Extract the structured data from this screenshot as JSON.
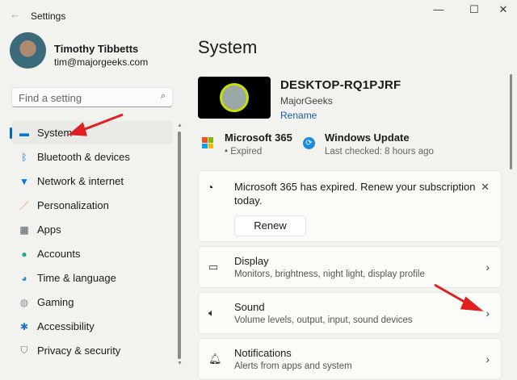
{
  "window": {
    "title": "Settings",
    "minimize": "—",
    "maximize": "☐",
    "close": "✕",
    "back": "←"
  },
  "user": {
    "name": "Timothy Tibbetts",
    "email": "tim@majorgeeks.com"
  },
  "search": {
    "placeholder": "Find a setting"
  },
  "nav": [
    {
      "label": "System",
      "icon": "monitor-icon",
      "glyph": "▬",
      "color": "#0078d4"
    },
    {
      "label": "Bluetooth & devices",
      "icon": "bluetooth-icon",
      "glyph": "ᛒ",
      "color": "#0078d4"
    },
    {
      "label": "Network & internet",
      "icon": "wifi-icon",
      "glyph": "▼",
      "color": "#0078d4"
    },
    {
      "label": "Personalization",
      "icon": "brush-icon",
      "glyph": "／",
      "color": "#e08a3c"
    },
    {
      "label": "Apps",
      "icon": "apps-icon",
      "glyph": "▦",
      "color": "#4a5560"
    },
    {
      "label": "Accounts",
      "icon": "person-icon",
      "glyph": "●",
      "color": "#2ba58a"
    },
    {
      "label": "Time & language",
      "icon": "globe-clock-icon",
      "glyph": "◕",
      "color": "#2a8bd0"
    },
    {
      "label": "Gaming",
      "icon": "gamepad-icon",
      "glyph": "◍",
      "color": "#8a9098"
    },
    {
      "label": "Accessibility",
      "icon": "accessibility-icon",
      "glyph": "✱",
      "color": "#1273c8"
    },
    {
      "label": "Privacy & security",
      "icon": "shield-icon",
      "glyph": "⛉",
      "color": "#777"
    }
  ],
  "main": {
    "title": "System",
    "device": {
      "name": "DESKTOP-RQ1PJRF",
      "subtitle": "MajorGeeks",
      "rename": "Rename"
    },
    "status": [
      {
        "title": "Microsoft 365",
        "subtitle": "• Expired"
      },
      {
        "title": "Windows Update",
        "subtitle": "Last checked: 8 hours ago"
      }
    ],
    "notice": {
      "text": "Microsoft 365 has expired. Renew your subscription today.",
      "button": "Renew",
      "close": "✕"
    },
    "items": [
      {
        "title": "Display",
        "subtitle": "Monitors, brightness, night light, display profile",
        "icon": "display-icon",
        "glyph": "▭"
      },
      {
        "title": "Sound",
        "subtitle": "Volume levels, output, input, sound devices",
        "icon": "speaker-icon",
        "glyph": "🔈︎"
      },
      {
        "title": "Notifications",
        "subtitle": "Alerts from apps and system",
        "icon": "bell-icon",
        "glyph": "🔔︎"
      }
    ]
  },
  "colors": {
    "accent": "#0067c0",
    "arrow": "#e02020"
  }
}
